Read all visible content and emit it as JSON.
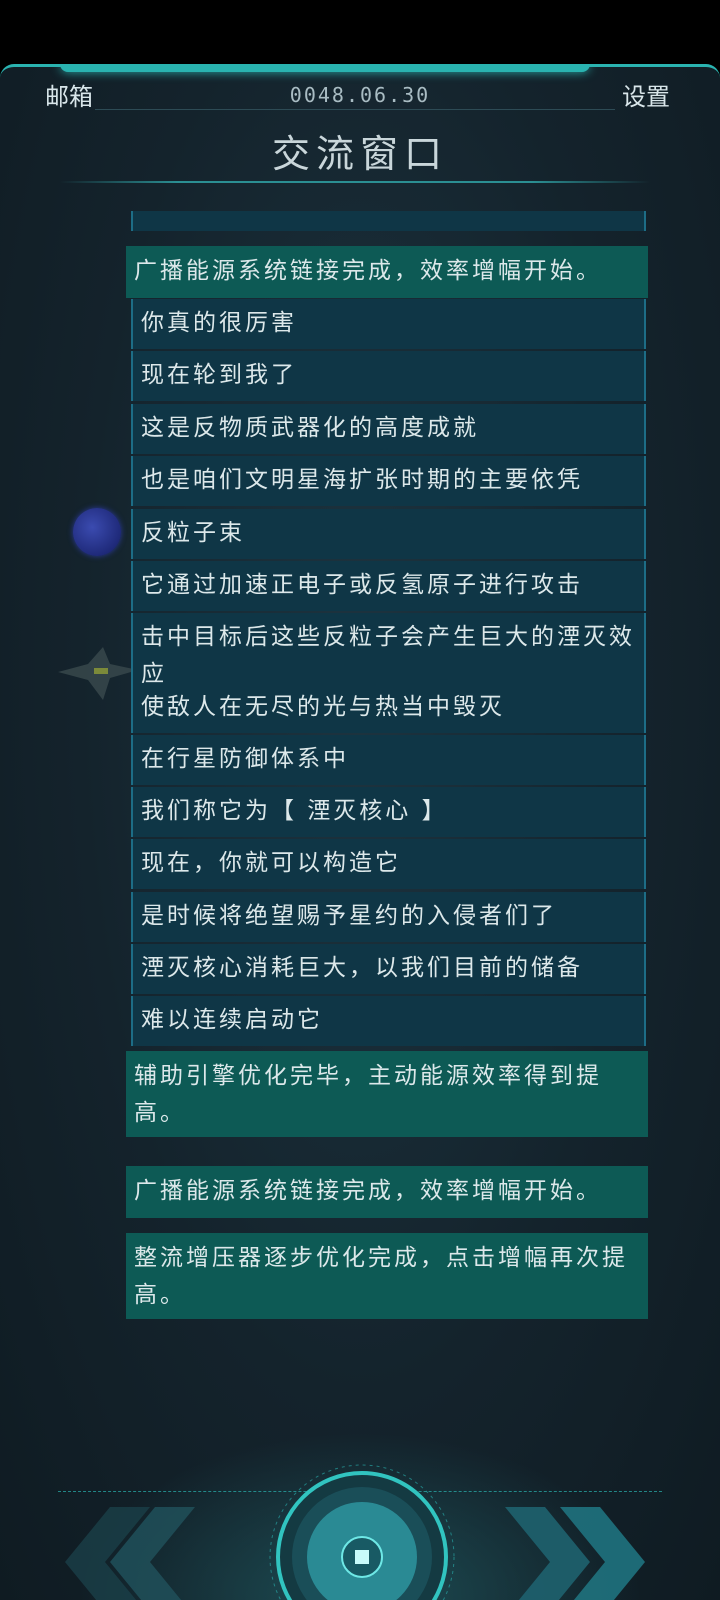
{
  "header": {
    "mail_label": "邮箱",
    "date": "0048.06.30",
    "settings_label": "设置",
    "title": "交流窗口"
  },
  "messages": [
    {
      "type": "system",
      "text": "广播能源系统链接完成，效率增幅开始。"
    },
    {
      "type": "dialog",
      "text": "你真的很厉害"
    },
    {
      "type": "dialog",
      "text": "现在轮到我了"
    },
    {
      "type": "dialog",
      "text": "这是反物质武器化的高度成就"
    },
    {
      "type": "dialog",
      "text": "也是咱们文明星海扩张时期的主要依凭"
    },
    {
      "type": "dialog",
      "text": "反粒子束"
    },
    {
      "type": "dialog",
      "text": "它通过加速正电子或反氢原子进行攻击"
    },
    {
      "type": "dialog",
      "text": "击中目标后这些反粒子会产生巨大的湮灭效应"
    },
    {
      "type": "dialog",
      "text": "使敌人在无尽的光与热当中毁灭"
    },
    {
      "type": "dialog",
      "text": "在行星防御体系中"
    },
    {
      "type": "dialog",
      "text": "我们称它为【 湮灭核心 】"
    },
    {
      "type": "dialog",
      "text": "现在，你就可以构造它"
    },
    {
      "type": "dialog",
      "text": "是时候将绝望赐予星约的入侵者们了"
    },
    {
      "type": "dialog",
      "text": "湮灭核心消耗巨大，以我们目前的储备"
    },
    {
      "type": "dialog",
      "text": "难以连续启动它"
    },
    {
      "type": "system",
      "text": "辅助引擎优化完毕，主动能源效率得到提高。"
    },
    {
      "type": "system",
      "text": "广播能源系统链接完成，效率增幅开始。"
    },
    {
      "type": "system",
      "text": "整流增压器逐步优化完成，点击增幅再次提高。"
    }
  ],
  "icons": {
    "left": "double-chevron-left-icon",
    "right": "double-chevron-right-icon",
    "center": "core-button-icon"
  },
  "colors": {
    "accent": "#2ab3b0",
    "dialog_bg": "#0f3646",
    "system_bg": "#0d5a55",
    "panel_bg": "#14232c"
  }
}
